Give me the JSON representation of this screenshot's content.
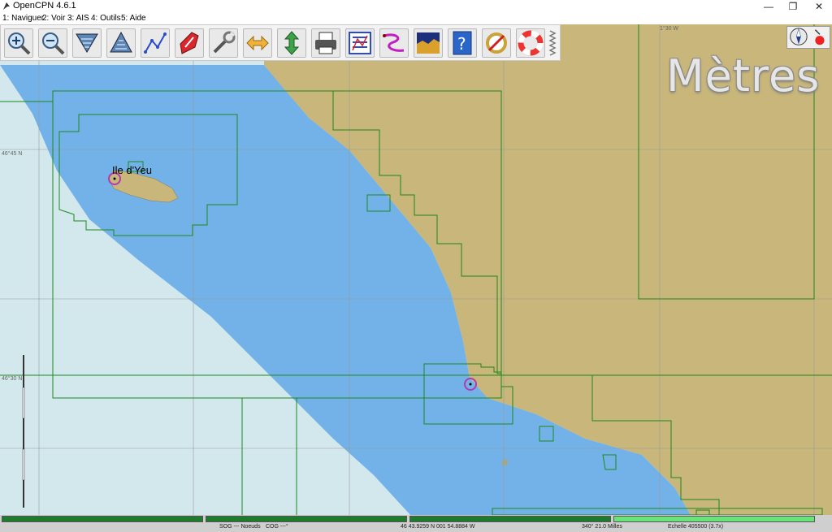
{
  "window": {
    "title": "OpenCPN 4.6.1",
    "controls": [
      "minimize-icon",
      "restore-icon",
      "close-icon"
    ]
  },
  "menu": {
    "items": [
      "1: Naviguer",
      "2: Voir",
      "3: AIS",
      "4: Outils",
      "5: Aide"
    ]
  },
  "toolbar": {
    "buttons": [
      {
        "name": "zoom-in-button",
        "icon": "zoom-in-icon"
      },
      {
        "name": "zoom-out-button",
        "icon": "zoom-out-icon"
      },
      {
        "name": "scale-in-button",
        "icon": "scale-in-icon"
      },
      {
        "name": "scale-out-button",
        "icon": "scale-out-icon"
      },
      {
        "name": "route-button",
        "icon": "route-icon"
      },
      {
        "name": "auto-follow-button",
        "icon": "boat-icon"
      },
      {
        "name": "settings-button",
        "icon": "wrench-icon"
      },
      {
        "name": "text-button",
        "icon": "text-icon"
      },
      {
        "name": "up-down-button",
        "icon": "up-down-icon"
      },
      {
        "name": "print-button",
        "icon": "print-icon"
      },
      {
        "name": "route-manager-button",
        "icon": "route-manager-icon"
      },
      {
        "name": "track-button",
        "icon": "track-icon"
      },
      {
        "name": "tide-button",
        "icon": "tide-icon"
      },
      {
        "name": "help-button",
        "icon": "help-icon"
      },
      {
        "name": "mob-tools-button",
        "icon": "tools-icon"
      },
      {
        "name": "mob-button",
        "icon": "lifebuoy-icon"
      }
    ]
  },
  "chart": {
    "depth_unit": "Mètres",
    "island_label": "Ile d'Yeu",
    "lat_labels": [
      "46°45 N",
      "46°30 N"
    ],
    "lon_label": "1°30 W",
    "colors": {
      "land": "#c8b67a",
      "deep_water": "#73b2e8",
      "shallow_water": "#d3e8ec",
      "chart_border": "#1b8a1b",
      "route_marker": "#b23ab2"
    }
  },
  "status": {
    "sog": "SOG --- Noeuds",
    "cog": "COG ---°",
    "position": "46 43.9259 N   001 54.8884 W",
    "bearing": "340°  21.0 Milles",
    "scale": "Echelle 405500 (3.7x)"
  }
}
